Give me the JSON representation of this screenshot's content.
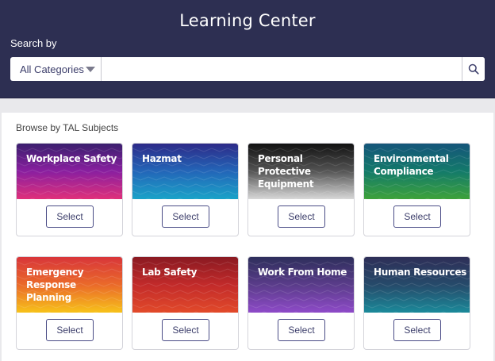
{
  "header": {
    "title": "Learning Center",
    "search_label": "Search by",
    "category_select": {
      "value": "All Categories",
      "icon": "chevron-down-icon"
    },
    "search_input": {
      "value": "",
      "placeholder": ""
    },
    "search_button": {
      "icon": "search-icon"
    }
  },
  "main": {
    "section_label": "Browse by TAL Subjects",
    "cards": [
      {
        "title": "Workplace Safety",
        "button_label": "Select",
        "colors": [
          "#3b1f6e",
          "#8a1fa0",
          "#e0307a"
        ]
      },
      {
        "title": "Hazmat",
        "button_label": "Select",
        "colors": [
          "#2d2a88",
          "#2366b8",
          "#1aa3c8"
        ]
      },
      {
        "title": "Personal Protective Equipment",
        "button_label": "Select",
        "colors": [
          "#111111",
          "#555555",
          "#d8d8d8"
        ]
      },
      {
        "title": "Environmental Compliance",
        "button_label": "Select",
        "colors": [
          "#15557a",
          "#137a6a",
          "#3ea23a"
        ]
      },
      {
        "title": "Emergency Response Planning",
        "button_label": "Select",
        "colors": [
          "#d8353a",
          "#ea6a2a",
          "#f7c21a"
        ]
      },
      {
        "title": "Lab Safety",
        "button_label": "Select",
        "colors": [
          "#8a1a22",
          "#c22a2a",
          "#e24a2a"
        ]
      },
      {
        "title": "Work From Home",
        "button_label": "Select",
        "colors": [
          "#2e2f5c",
          "#5a3c8a",
          "#8e4ac8"
        ]
      },
      {
        "title": "Human Resources",
        "button_label": "Select",
        "colors": [
          "#2e2f58",
          "#264a6a",
          "#1b8a9a"
        ]
      }
    ]
  }
}
